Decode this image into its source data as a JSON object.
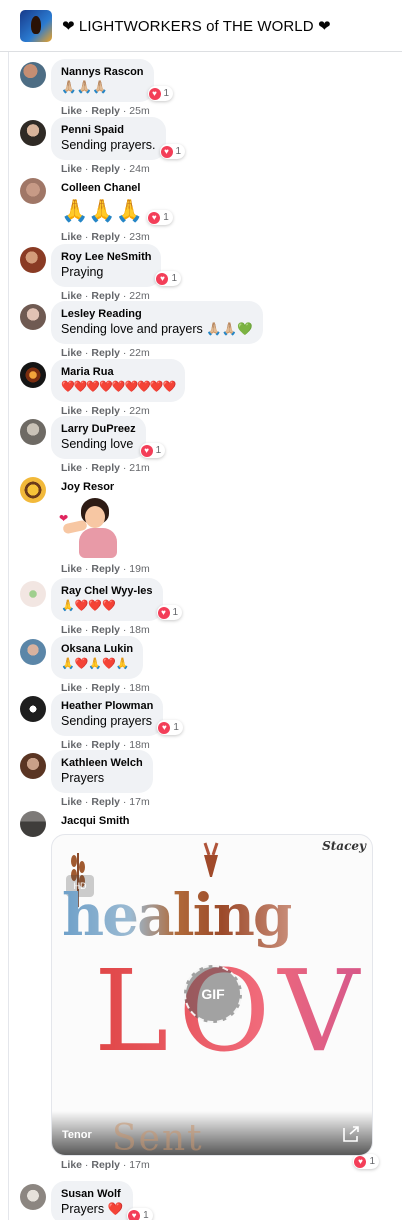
{
  "header": {
    "title": "❤ LIGHTWORKERS of THE WORLD ❤"
  },
  "actions": {
    "like": "Like",
    "reply": "Reply"
  },
  "comments": [
    {
      "author": "Nannys Rascon",
      "text": "🙏🏼🙏🏼🙏🏼",
      "reactions": "1",
      "time": "25m"
    },
    {
      "author": "Penni Spaid",
      "text": "Sending prayers.",
      "reactions": "1",
      "time": "24m"
    },
    {
      "author": "Colleen Chanel",
      "text": "🙏🙏🙏",
      "reactions": "1",
      "time": "23m"
    },
    {
      "author": "Roy Lee NeSmith",
      "text": "Praying",
      "reactions": "1",
      "time": "22m"
    },
    {
      "author": "Lesley Reading",
      "text": "Sending love and prayers 🙏🏼🙏🏼💚",
      "reactions": "",
      "time": "22m"
    },
    {
      "author": "Maria Rua",
      "text": "❤️❤️❤️❤️❤️❤️❤️❤️❤️",
      "reactions": "",
      "time": "22m"
    },
    {
      "author": "Larry DuPreez",
      "text": "Sending love",
      "reactions": "1",
      "time": "21m"
    },
    {
      "author": "Joy Resor",
      "text": "",
      "reactions": "",
      "time": "19m"
    },
    {
      "author": "Ray Chel Wyy-les",
      "text": "🙏❤️❤️❤️",
      "reactions": "1",
      "time": "18m"
    },
    {
      "author": "Oksana Lukin",
      "text": "🙏❤️🙏❤️🙏",
      "reactions": "",
      "time": "18m"
    },
    {
      "author": "Heather Plowman",
      "text": "Sending prayers",
      "reactions": "1",
      "time": "18m"
    },
    {
      "author": "Kathleen Welch",
      "text": "Prayers",
      "reactions": "",
      "time": "17m"
    },
    {
      "author": "Jacqui Smith",
      "text": "",
      "reactions": "1",
      "time": "17m"
    },
    {
      "author": "Susan Wolf",
      "text": "Prayers ❤️",
      "reactions": "1",
      "time": ""
    }
  ],
  "gif": {
    "line1": "healing",
    "line2": "LOVE",
    "line3": "Sent",
    "watermark": "Stacey",
    "hd": "HD",
    "play": "GIF",
    "provider": "Tenor"
  },
  "colors": {
    "reaction_heart": "#f33e58",
    "bubble": "#f0f2f5",
    "meta": "#65676b"
  }
}
